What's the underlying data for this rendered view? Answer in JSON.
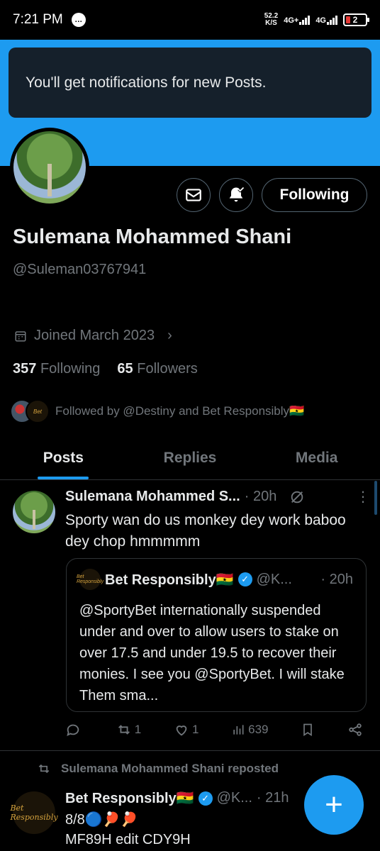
{
  "status_bar": {
    "time": "7:21 PM",
    "net_speed_value": "52.2",
    "net_speed_unit": "K/S",
    "signal1": "4G+",
    "signal2": "4G",
    "battery": "2"
  },
  "toast": {
    "message": "You'll get notifications for new Posts."
  },
  "profile": {
    "name": "Sulemana Mohammed Shani",
    "handle": "@Suleman03767941",
    "joined": "Joined March 2023",
    "following_count": "357",
    "following_label": "Following",
    "followers_count": "65",
    "followers_label": "Followers",
    "followed_by": "Followed by @Destiny and Bet Responsibly🇬🇭",
    "follow_button": "Following"
  },
  "tabs": [
    {
      "label": "Posts",
      "active": true
    },
    {
      "label": "Replies",
      "active": false
    },
    {
      "label": "Media",
      "active": false
    }
  ],
  "post1": {
    "author": "Sulemana Mohammed S...",
    "time": "· 20h",
    "text": "Sporty wan do us monkey  dey work baboo dey chop hmmmmm",
    "quote": {
      "author": "Bet Responsibly🇬🇭",
      "handle": "@K...",
      "time": "· 20h",
      "avatar_text": "Bet Responsibly",
      "text": "@SportyBet internationally suspended under and over to allow users to stake on over 17.5 and under 19.5 to recover their monies. I see you @SportyBet.  I will  stake Them  sma..."
    },
    "actions": {
      "replies": "",
      "reposts": "1",
      "likes": "1",
      "views": "639"
    }
  },
  "post2": {
    "repost_label": "Sulemana Mohammed Shani reposted",
    "author": "Bet Responsibly🇬🇭",
    "handle": "@K...",
    "time": "· 21h",
    "avatar_text": "Bet Responsibly",
    "line1": "8/8🔵🏓🏓",
    "line2": "MF89H edit CDY9H"
  },
  "fab": {
    "label": "+"
  },
  "colors": {
    "accent": "#1d9bf0",
    "background": "#000000",
    "muted": "#71767b"
  }
}
